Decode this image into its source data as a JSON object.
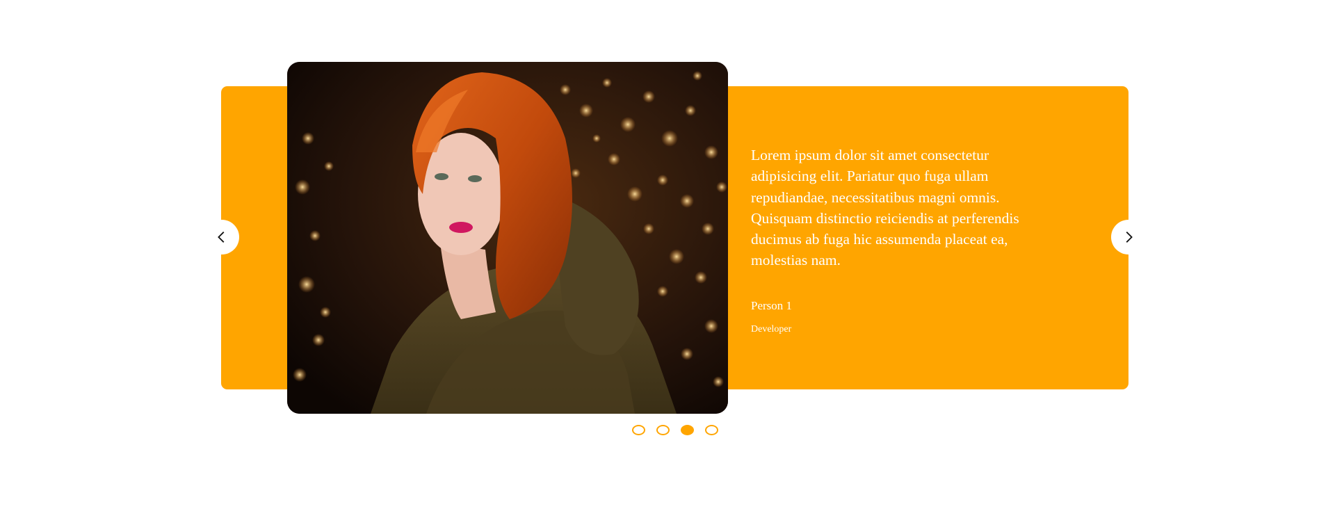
{
  "testimonial": {
    "quote": "Lorem ipsum dolor sit amet consectetur adipisicing elit. Pariatur quo fuga ullam repudiandae, necessitatibus magni omnis. Quisquam distinctio reiciendis at perferendis ducimus ab fuga hic assumenda placeat ea, molestias nam.",
    "name": "Person 1",
    "role": "Developer"
  },
  "photo": {
    "subject": "portrait of red-haired woman in olive puffer jacket against golden bokeh lights"
  },
  "controls": {
    "prev_icon": "chevron-left-icon",
    "next_icon": "chevron-right-icon"
  },
  "pagination": {
    "total": 4,
    "active_index": 3
  },
  "colors": {
    "accent": "#ffa500",
    "text": "#ffffff",
    "background": "#ffffff"
  }
}
